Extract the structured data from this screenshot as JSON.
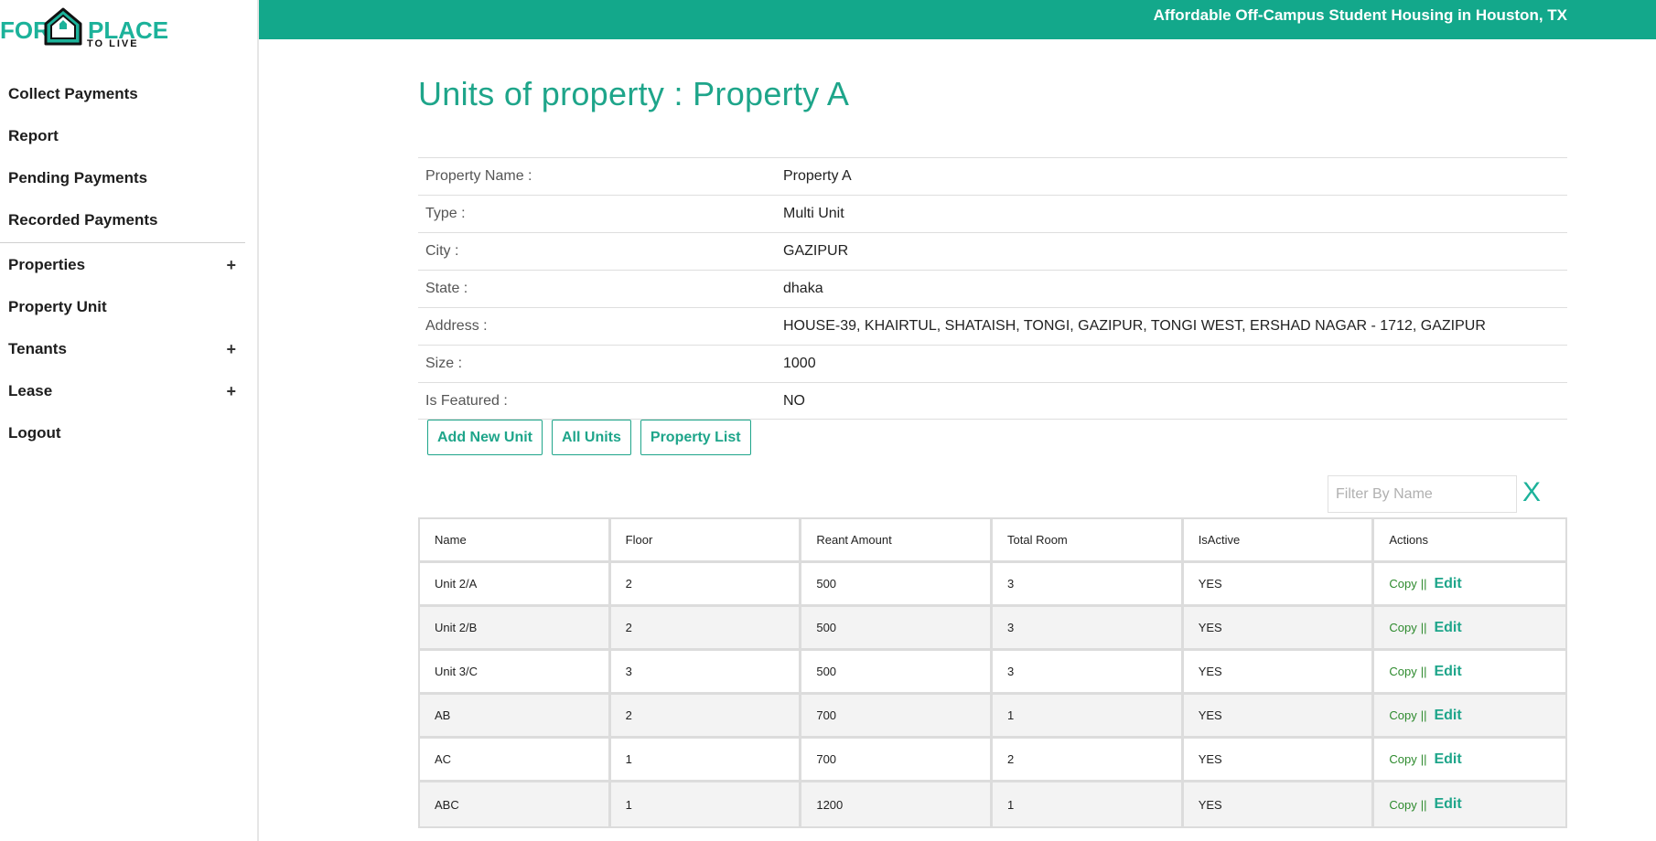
{
  "logo": {
    "word1": "FOR",
    "word2": "PLACE",
    "tagline": "TO LIVE"
  },
  "header": {
    "tagline": "Affordable Off-Campus Student Housing in Houston, TX"
  },
  "sidebar": {
    "items": [
      {
        "label": "Collect Payments",
        "expandable": false
      },
      {
        "label": "Report",
        "expandable": false
      },
      {
        "label": "Pending Payments",
        "expandable": false
      },
      {
        "label": "Recorded Payments",
        "expandable": false
      },
      {
        "label": "Properties",
        "expandable": true,
        "expand_symbol": "+"
      },
      {
        "label": "Property Unit",
        "expandable": false
      },
      {
        "label": "Tenants",
        "expandable": true,
        "expand_symbol": "+"
      },
      {
        "label": "Lease",
        "expandable": true,
        "expand_symbol": "+"
      },
      {
        "label": "Logout",
        "expandable": false
      }
    ]
  },
  "page": {
    "title": "Units of property : Property A"
  },
  "details": {
    "rows": [
      {
        "label": "Property Name :",
        "value": "Property A"
      },
      {
        "label": "Type :",
        "value": "Multi Unit"
      },
      {
        "label": "City :",
        "value": "GAZIPUR"
      },
      {
        "label": "State :",
        "value": "dhaka"
      },
      {
        "label": "Address :",
        "value": "HOUSE-39, KHAIRTUL, SHATAISH, TONGI, GAZIPUR, TONGI WEST, ERSHAD NAGAR - 1712, GAZIPUR"
      },
      {
        "label": "Size :",
        "value": "1000"
      },
      {
        "label": "Is Featured :",
        "value": "NO"
      }
    ]
  },
  "actions": {
    "add_new_unit": "Add New Unit",
    "all_units": "All Units",
    "property_list": "Property List"
  },
  "filter": {
    "placeholder": "Filter By Name",
    "value": "",
    "clear_label": "X"
  },
  "units_table": {
    "headers": [
      "Name",
      "Floor",
      "Reant Amount",
      "Total Room",
      "IsActive",
      "Actions"
    ],
    "rows": [
      {
        "name": "Unit 2/A",
        "floor": "2",
        "rent": "500",
        "rooms": "3",
        "active": "YES"
      },
      {
        "name": "Unit 2/B",
        "floor": "2",
        "rent": "500",
        "rooms": "3",
        "active": "YES"
      },
      {
        "name": "Unit 3/C",
        "floor": "3",
        "rent": "500",
        "rooms": "3",
        "active": "YES"
      },
      {
        "name": "AB",
        "floor": "2",
        "rent": "700",
        "rooms": "1",
        "active": "YES"
      },
      {
        "name": "AC",
        "floor": "1",
        "rent": "700",
        "rooms": "2",
        "active": "YES"
      },
      {
        "name": "ABC",
        "floor": "1",
        "rent": "1200",
        "rooms": "1",
        "active": "YES"
      }
    ],
    "action_copy": "Copy",
    "action_sep": "||",
    "action_edit": "Edit"
  },
  "colors": {
    "brand": "#13a88b",
    "accent": "#1ea58a",
    "copy_link": "#2d8a2d"
  }
}
